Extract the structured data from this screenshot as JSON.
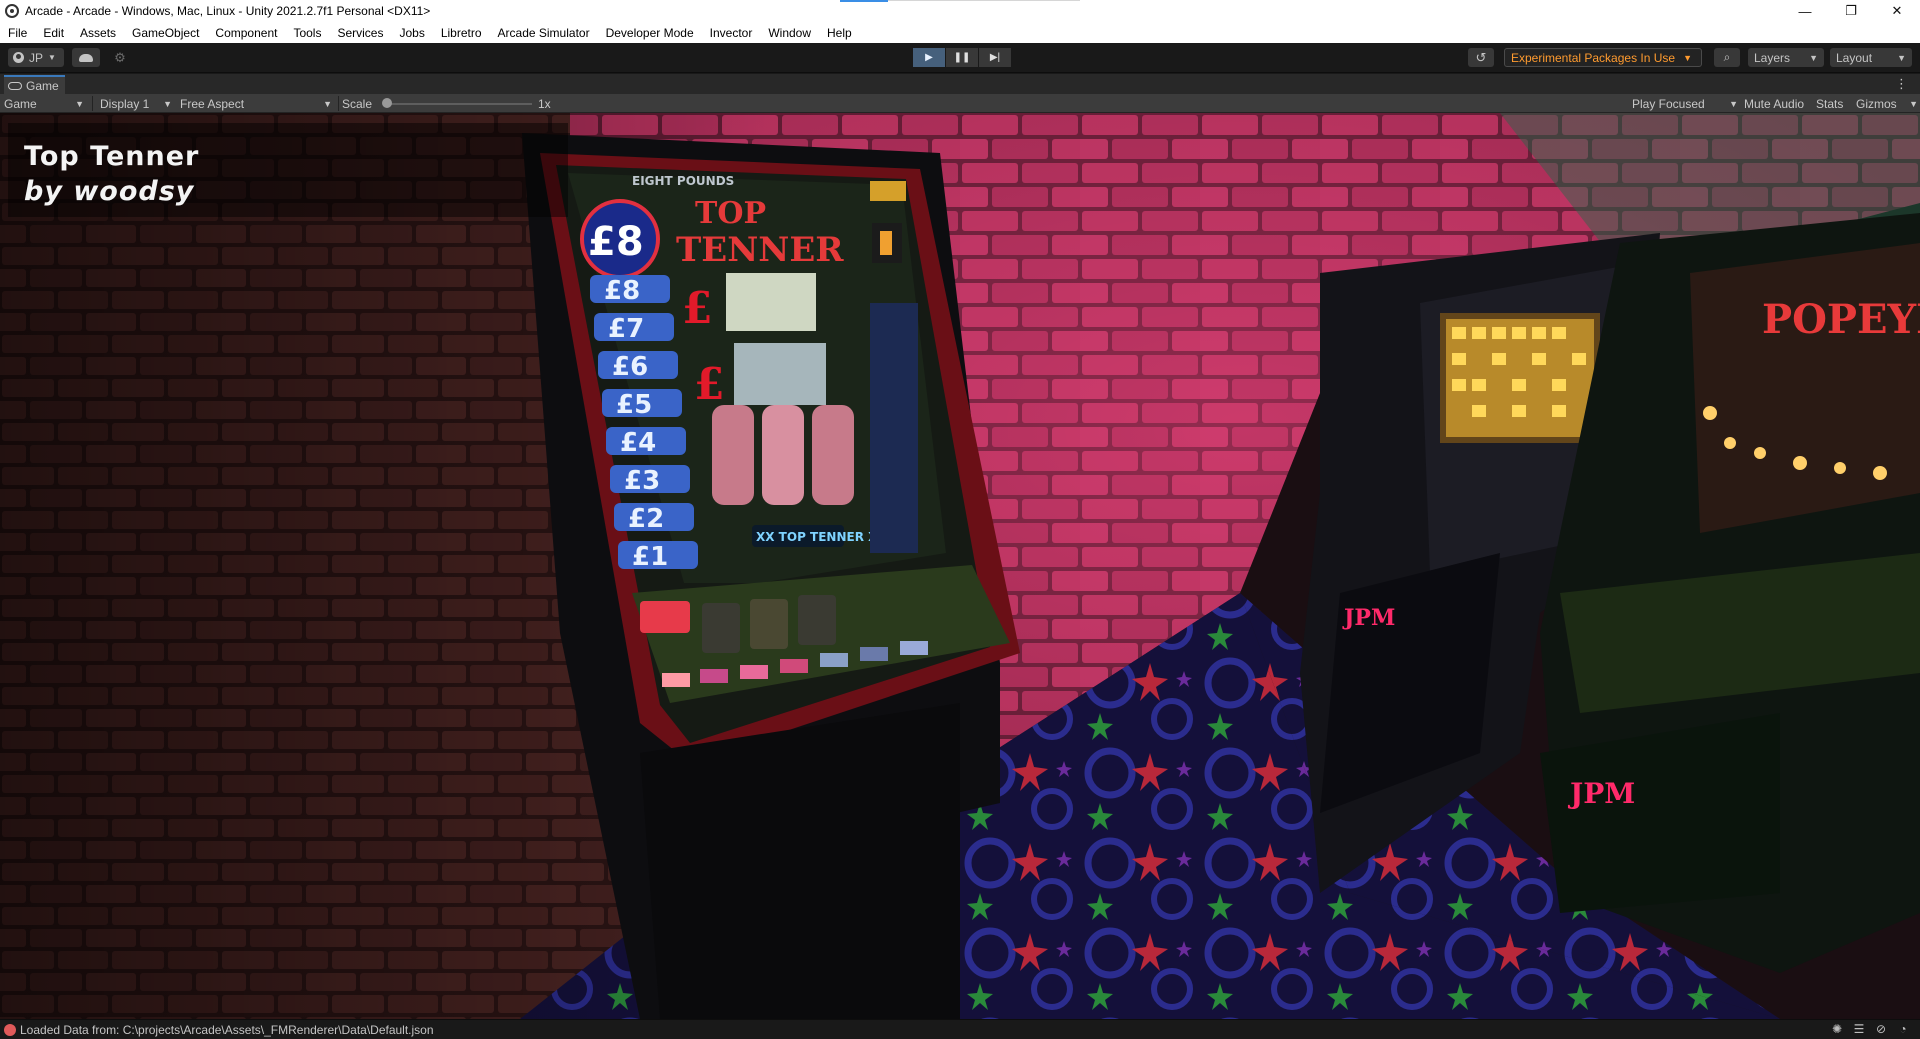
{
  "window": {
    "title": "Arcade - Arcade - Windows, Mac, Linux - Unity 2021.2.7f1 Personal <DX11>",
    "controls": {
      "minimize": "—",
      "restore": "❐",
      "close": "✕"
    }
  },
  "menu": [
    "File",
    "Edit",
    "Assets",
    "GameObject",
    "Component",
    "Tools",
    "Services",
    "Jobs",
    "Libretro",
    "Arcade Simulator",
    "Developer Mode",
    "Invector",
    "Window",
    "Help"
  ],
  "toolbar": {
    "account_label": "JP",
    "play_icon": "▶",
    "pause_icon": "❚❚",
    "step_icon": "▶|",
    "history_icon": "↺",
    "experimental_label": "Experimental Packages In Use",
    "search_icon": "⌕",
    "layers_label": "Layers",
    "layout_label": "Layout"
  },
  "game_tab": {
    "label": "Game",
    "menu_icon": "⋮"
  },
  "game_toolbar": {
    "view_mode": "Game",
    "display": "Display 1",
    "aspect": "Free Aspect",
    "scale_label": "Scale",
    "scale_value": "1x",
    "play_focused": "Play Focused",
    "mute_audio": "Mute Audio",
    "stats": "Stats",
    "gizmos": "Gizmos"
  },
  "overlay": {
    "title": "Top Tenner",
    "subtitle": "by woodsy"
  },
  "machines": {
    "main": {
      "header": "EIGHT POUNDS",
      "jackpot": "£8",
      "name_top": "TOP",
      "name_bottom": "TENNER",
      "reel_label": "XX TOP TENNER XX",
      "ladder": [
        "£8",
        "£7",
        "£6",
        "£5",
        "£4",
        "£3",
        "£2",
        "£1"
      ]
    },
    "left_cabinet": {
      "brand": "JPM"
    },
    "right_cabinet": {
      "brand": "JPM",
      "game": "POPEYE"
    }
  },
  "status": {
    "message": "Loaded Data from: C:\\projects\\Arcade\\Assets\\_FMRenderer\\Data\\Default.json"
  },
  "colors": {
    "accent_orange": "#ff9b2f",
    "play_active": "#46607c",
    "tab_accent": "#3a79bb"
  }
}
